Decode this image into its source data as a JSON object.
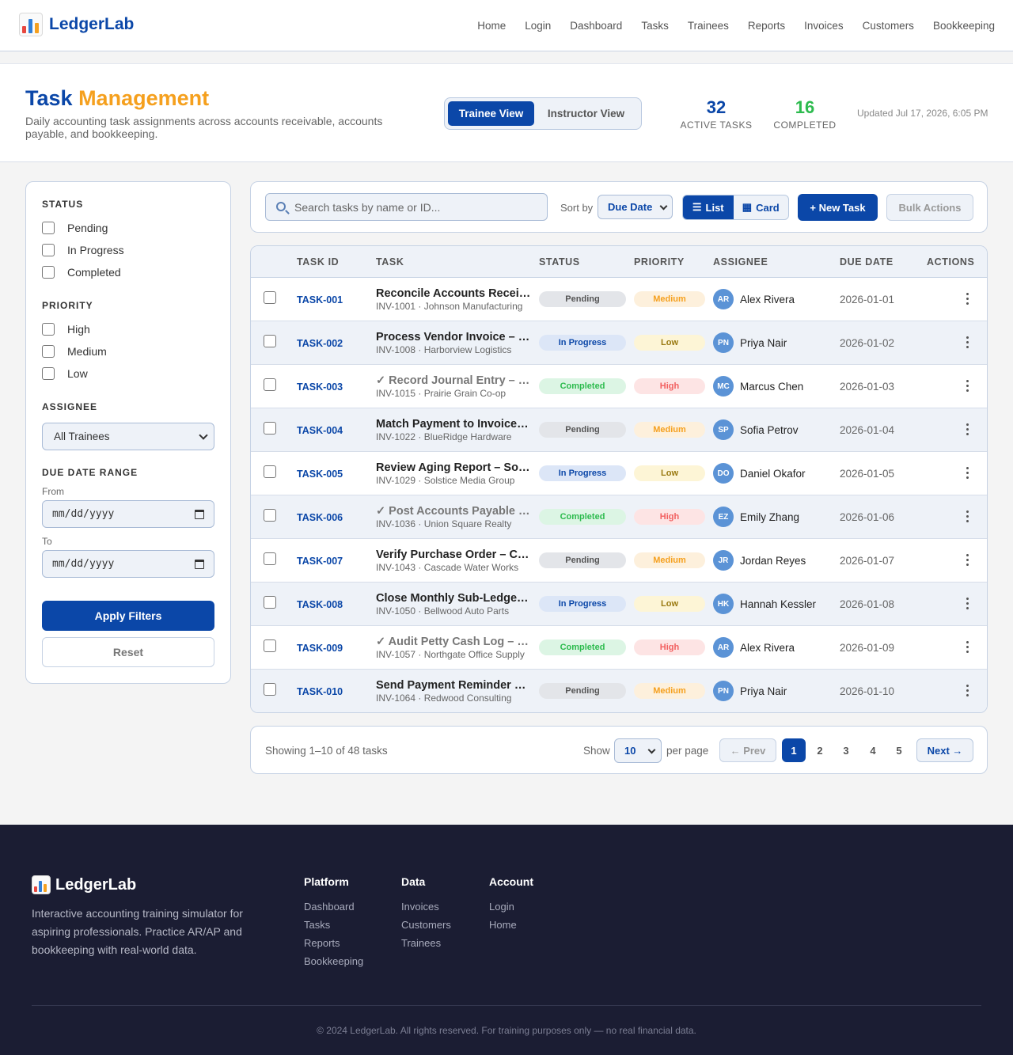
{
  "brand": {
    "name": "LedgerLab",
    "icon": "bar-chart-icon"
  },
  "nav": [
    "Home",
    "Login",
    "Dashboard",
    "Tasks",
    "Trainees",
    "Reports",
    "Invoices",
    "Customers",
    "Bookkeeping"
  ],
  "header": {
    "title_part1": "Task",
    "title_part2": "Management",
    "subtitle": "Daily accounting task assignments across accounts receivable, accounts payable, and bookkeeping.",
    "views": {
      "active": "Trainee View",
      "inactive": "Instructor View"
    },
    "stats": {
      "active": {
        "value": "32",
        "label": "ACTIVE TASKS"
      },
      "completed": {
        "value": "16",
        "label": "COMPLETED"
      }
    },
    "updated": "Updated Jul 17, 2026, 6:05 PM"
  },
  "filters": {
    "status_heading": "STATUS",
    "status_options": [
      "Pending",
      "In Progress",
      "Completed"
    ],
    "priority_heading": "PRIORITY",
    "priority_options": [
      "High",
      "Medium",
      "Low"
    ],
    "assignee_heading": "ASSIGNEE",
    "assignee_value": "All Trainees",
    "date_heading": "DUE DATE RANGE",
    "from_label": "From",
    "to_label": "To",
    "date_placeholder": "mm/dd/yyyy",
    "apply": "Apply Filters",
    "reset": "Reset"
  },
  "toolbar": {
    "search_placeholder": "Search tasks by name or ID...",
    "sort_label": "Sort by",
    "sort_value": "Due Date",
    "list_label": "List",
    "card_label": "Card",
    "new_task": "+ New Task",
    "bulk_actions": "Bulk Actions"
  },
  "table": {
    "headers": [
      "TASK ID",
      "TASK",
      "STATUS",
      "PRIORITY",
      "ASSIGNEE",
      "DUE DATE",
      "ACTIONS"
    ],
    "rows": [
      {
        "id": "TASK-001",
        "title": "Reconcile Accounts Receivable – Johnson Manufacturing",
        "sub": "INV-1001 · Johnson Manufacturing",
        "status": "Pending",
        "priority": "Medium",
        "initials": "AR",
        "assignee": "Alex Rivera",
        "due": "2026-01-01",
        "done": false
      },
      {
        "id": "TASK-002",
        "title": "Process Vendor Invoice – Harborview Logistics",
        "sub": "INV-1008 · Harborview Logistics",
        "status": "In Progress",
        "priority": "Low",
        "initials": "PN",
        "assignee": "Priya Nair",
        "due": "2026-01-02",
        "done": false
      },
      {
        "id": "TASK-003",
        "title": "✓ Record Journal Entry – Prairie Grain Co-op",
        "sub": "INV-1015 · Prairie Grain Co-op",
        "status": "Completed",
        "priority": "High",
        "initials": "MC",
        "assignee": "Marcus Chen",
        "due": "2026-01-03",
        "done": true
      },
      {
        "id": "TASK-004",
        "title": "Match Payment to Invoice – BlueRidge Hardware",
        "sub": "INV-1022 · BlueRidge Hardware",
        "status": "Pending",
        "priority": "Medium",
        "initials": "SP",
        "assignee": "Sofia Petrov",
        "due": "2026-01-04",
        "done": false
      },
      {
        "id": "TASK-005",
        "title": "Review Aging Report – Solstice Media Group",
        "sub": "INV-1029 · Solstice Media Group",
        "status": "In Progress",
        "priority": "Low",
        "initials": "DO",
        "assignee": "Daniel Okafor",
        "due": "2026-01-05",
        "done": false
      },
      {
        "id": "TASK-006",
        "title": "✓ Post Accounts Payable – Union Square Realty",
        "sub": "INV-1036 · Union Square Realty",
        "status": "Completed",
        "priority": "High",
        "initials": "EZ",
        "assignee": "Emily Zhang",
        "due": "2026-01-06",
        "done": true
      },
      {
        "id": "TASK-007",
        "title": "Verify Purchase Order – Cascade Water Works",
        "sub": "INV-1043 · Cascade Water Works",
        "status": "Pending",
        "priority": "Medium",
        "initials": "JR",
        "assignee": "Jordan Reyes",
        "due": "2026-01-07",
        "done": false
      },
      {
        "id": "TASK-008",
        "title": "Close Monthly Sub-Ledger – Bellwood Auto Parts",
        "sub": "INV-1050 · Bellwood Auto Parts",
        "status": "In Progress",
        "priority": "Low",
        "initials": "HK",
        "assignee": "Hannah Kessler",
        "due": "2026-01-08",
        "done": false
      },
      {
        "id": "TASK-009",
        "title": "✓ Audit Petty Cash Log – Northgate Office Supply",
        "sub": "INV-1057 · Northgate Office Supply",
        "status": "Completed",
        "priority": "High",
        "initials": "AR",
        "assignee": "Alex Rivera",
        "due": "2026-01-09",
        "done": true
      },
      {
        "id": "TASK-010",
        "title": "Send Payment Reminder – Redwood Consulting",
        "sub": "INV-1064 · Redwood Consulting",
        "status": "Pending",
        "priority": "Medium",
        "initials": "PN",
        "assignee": "Priya Nair",
        "due": "2026-01-10",
        "done": false
      }
    ]
  },
  "colors": {
    "status": {
      "Pending": {
        "bg": "#e3e5e9",
        "fg": "#555555"
      },
      "In Progress": {
        "bg": "#dce6f7",
        "fg": "#0b47a8"
      },
      "Completed": {
        "bg": "#dcf5e4",
        "fg": "#2dbb4e"
      }
    },
    "priority": {
      "High": {
        "bg": "#fde4e4",
        "fg": "#f26060"
      },
      "Medium": {
        "bg": "#fdf0dc",
        "fg": "#f5a01e"
      },
      "Low": {
        "bg": "#fdf5d6",
        "fg": "#9a7a12"
      }
    }
  },
  "pagination": {
    "showing": "Showing 1–10 of 48 tasks",
    "show_label": "Show",
    "per_page_value": "10",
    "per_page_label": "per page",
    "prev": "← Prev",
    "pages": [
      "1",
      "2",
      "3",
      "4",
      "5"
    ],
    "current": "1",
    "next": "Next →"
  },
  "footer": {
    "brand": "LedgerLab",
    "description": "Interactive accounting training simulator for aspiring professionals. Practice AR/AP and bookkeeping with real-world data.",
    "columns": [
      {
        "heading": "Platform",
        "links": [
          "Dashboard",
          "Tasks",
          "Reports",
          "Bookkeeping"
        ]
      },
      {
        "heading": "Data",
        "links": [
          "Invoices",
          "Customers",
          "Trainees"
        ]
      },
      {
        "heading": "Account",
        "links": [
          "Login",
          "Home"
        ]
      }
    ],
    "copyright": "© 2024 LedgerLab. All rights reserved. For training purposes only — no real financial data."
  }
}
